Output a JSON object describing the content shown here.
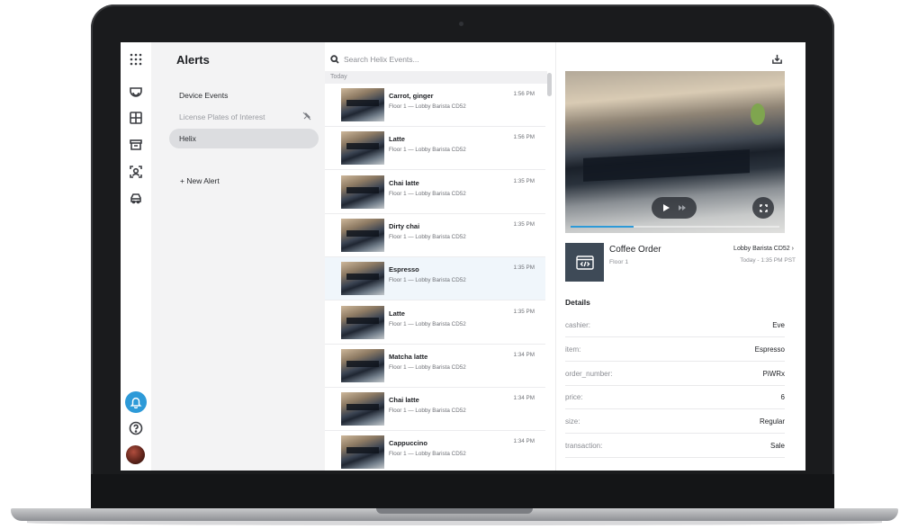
{
  "nav": {
    "rail_icons": [
      "apps-grid-icon",
      "camera-dome-icon",
      "floorplan-icon",
      "archive-icon",
      "face-scan-icon",
      "vehicle-icon"
    ],
    "active_icon": "bell-icon",
    "accent": "#2d9ad8"
  },
  "alerts": {
    "title": "Alerts",
    "items": [
      {
        "label": "Device Events"
      },
      {
        "label": "License Plates of Interest"
      },
      {
        "label": "Helix"
      }
    ],
    "selected": "Helix",
    "new_alert_label": "+ New Alert"
  },
  "events": {
    "search_placeholder": "Search Helix Events...",
    "section": "Today",
    "rows": [
      {
        "title": "Carrot, ginger",
        "sub": "Floor 1 — Lobby Barista CD52",
        "time": "1:56 PM"
      },
      {
        "title": "Latte",
        "sub": "Floor 1 — Lobby Barista CD52",
        "time": "1:56 PM"
      },
      {
        "title": "Chai latte",
        "sub": "Floor 1 — Lobby Barista CD52",
        "time": "1:35 PM"
      },
      {
        "title": "Dirty chai",
        "sub": "Floor 1 — Lobby Barista CD52",
        "time": "1:35 PM"
      },
      {
        "title": "Espresso",
        "sub": "Floor 1 — Lobby Barista CD52",
        "time": "1:35 PM"
      },
      {
        "title": "Latte",
        "sub": "Floor 1 — Lobby Barista CD52",
        "time": "1:35 PM"
      },
      {
        "title": "Matcha latte",
        "sub": "Floor 1 — Lobby Barista CD52",
        "time": "1:34 PM"
      },
      {
        "title": "Chai latte",
        "sub": "Floor 1 — Lobby Barista CD52",
        "time": "1:34 PM"
      },
      {
        "title": "Cappuccino",
        "sub": "Floor 1 — Lobby Barista CD52",
        "time": "1:34 PM"
      }
    ],
    "selected_index": 4
  },
  "detail": {
    "event_title": "Coffee Order",
    "event_sub": "Floor 1",
    "camera": "Lobby Barista CD52",
    "camera_chevron": "›",
    "time": "Today - 1:35 PM PST",
    "video_progress": 0.3,
    "details_heading": "Details",
    "fields": [
      {
        "key": "cashier:",
        "value": "Eve"
      },
      {
        "key": "item:",
        "value": "Espresso"
      },
      {
        "key": "order_number:",
        "value": "PiWRx"
      },
      {
        "key": "price:",
        "value": "6"
      },
      {
        "key": "size:",
        "value": "Regular"
      },
      {
        "key": "transaction:",
        "value": "Sale"
      }
    ]
  }
}
